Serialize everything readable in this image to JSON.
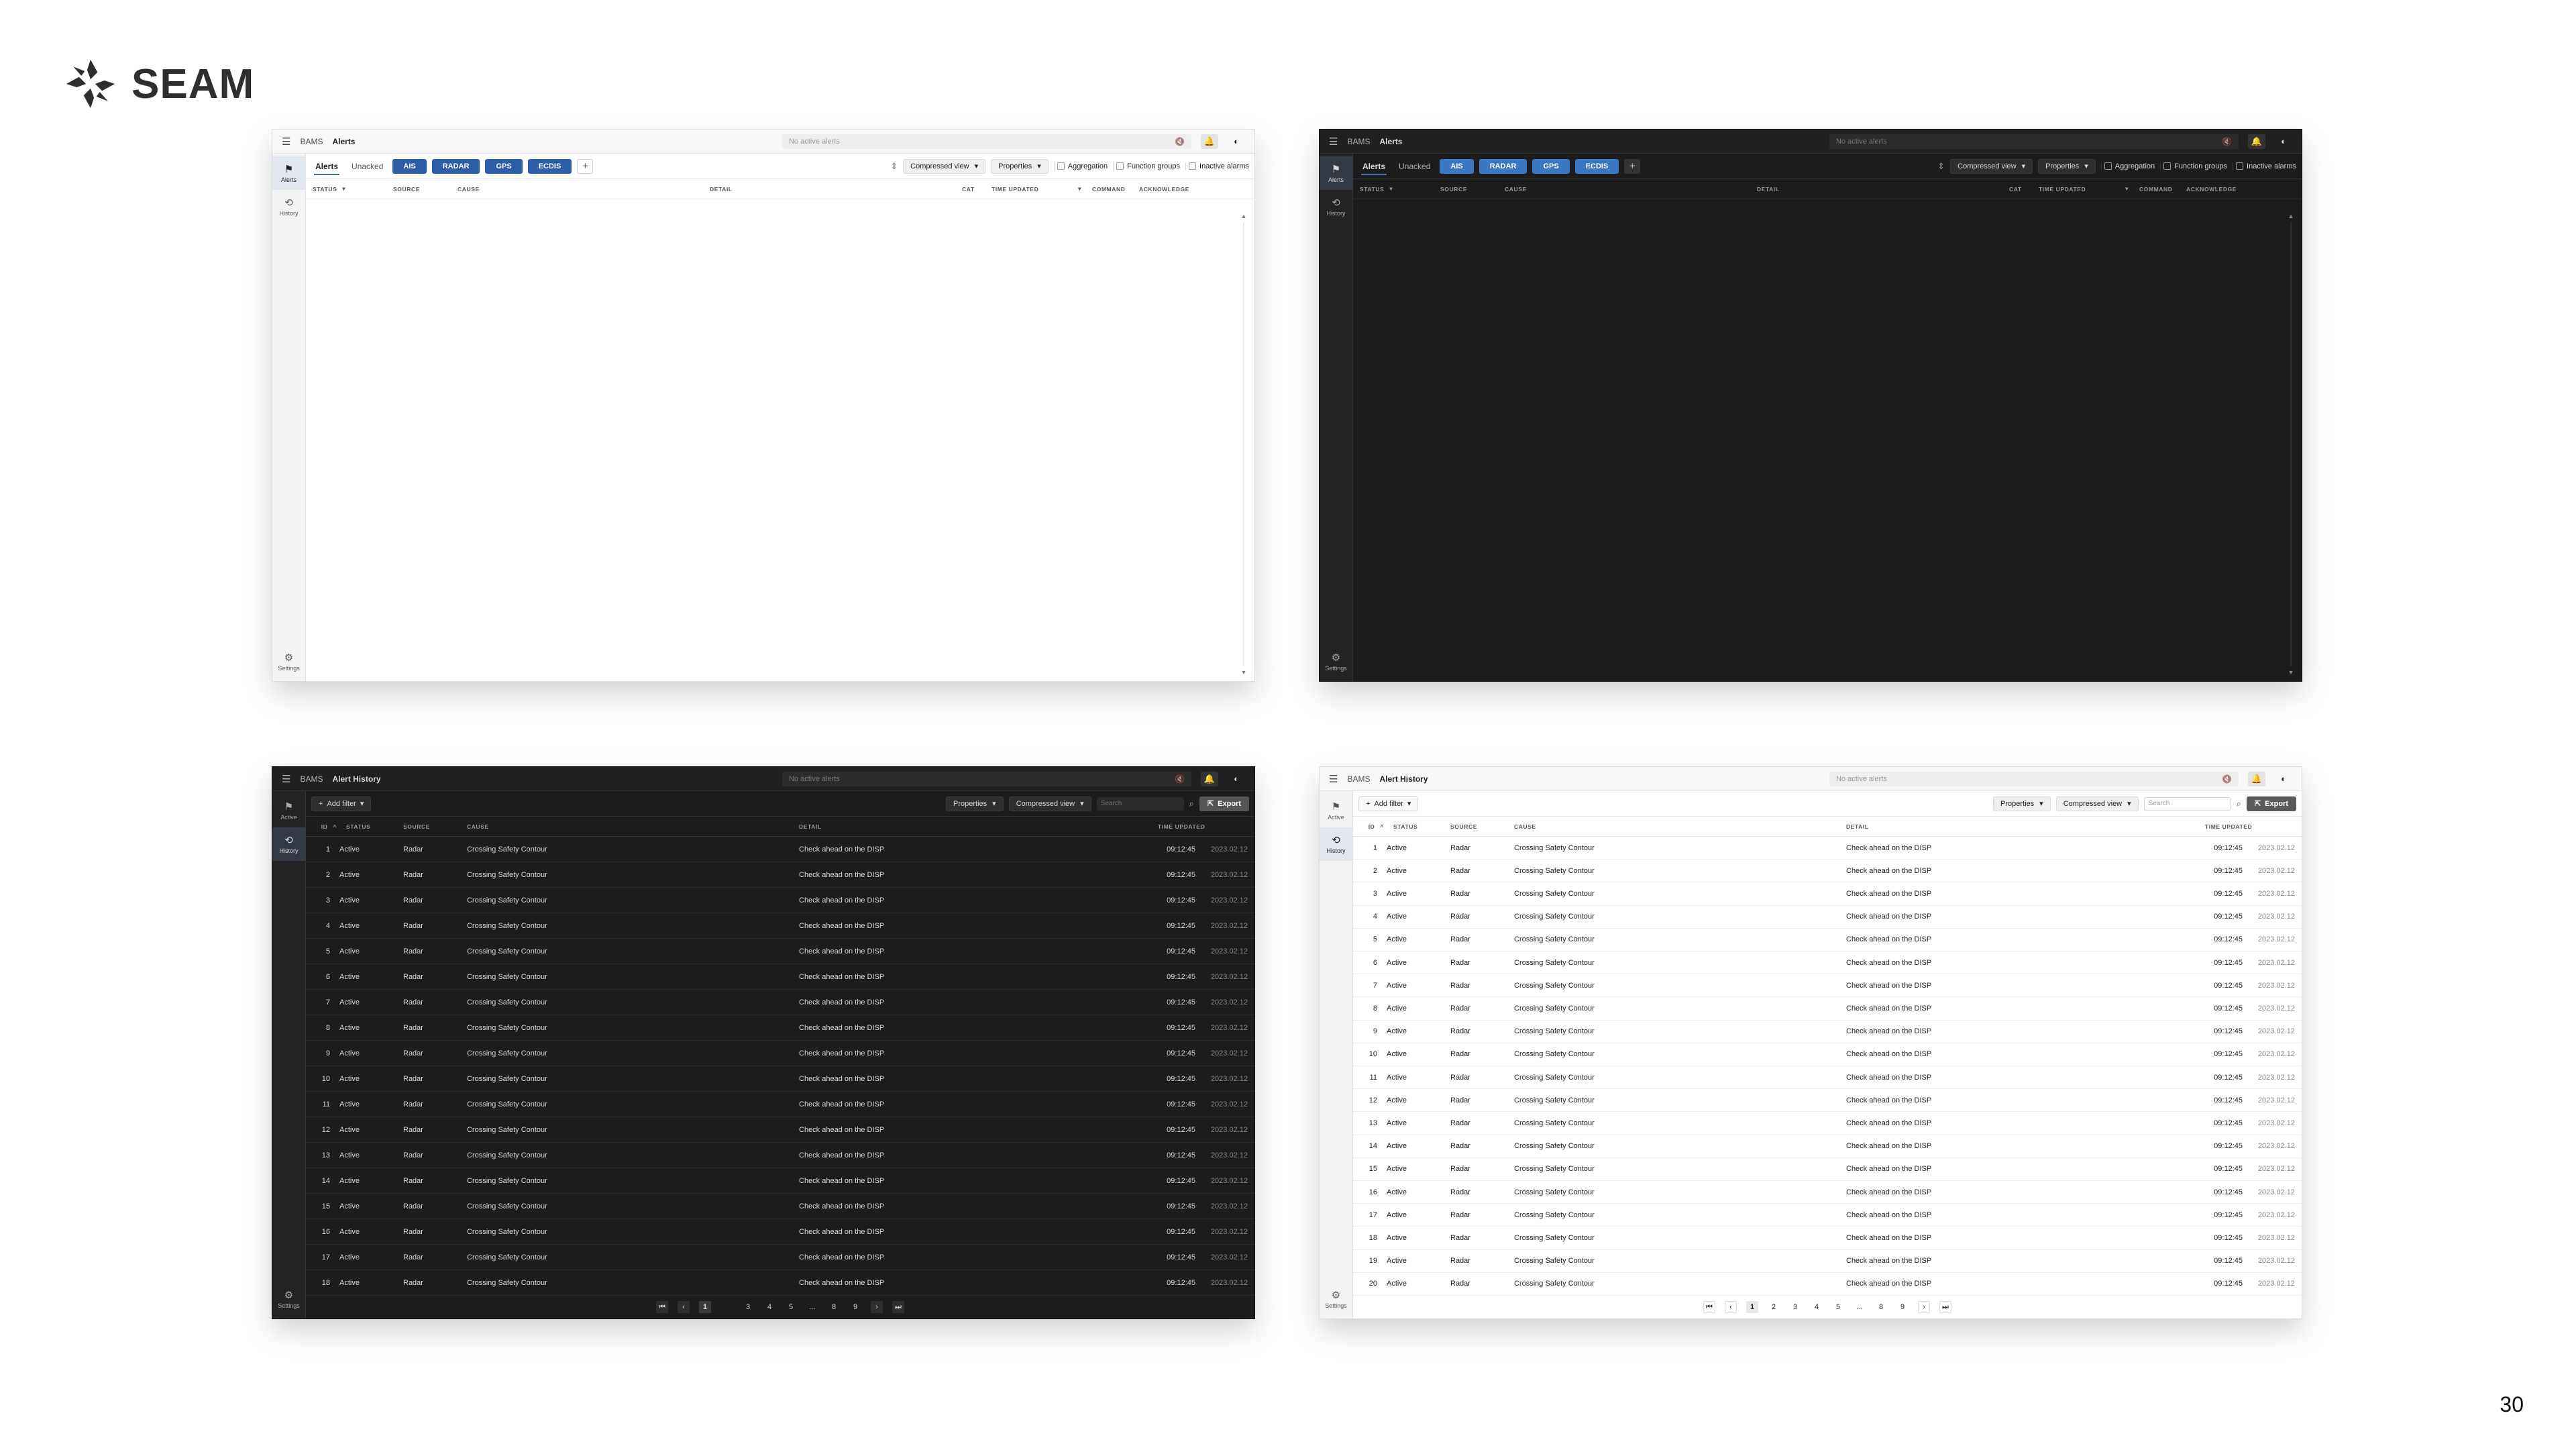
{
  "logo": {
    "text": "SEAM"
  },
  "page_number": "30",
  "common": {
    "app_name": "BAMS",
    "status_placeholder": "No active alerts",
    "settings_label": "Settings",
    "history_label": "History",
    "active_label": "Active",
    "alerts_label": "Alerts"
  },
  "alerts_view": {
    "title": "Alerts",
    "tabs": [
      "Alerts",
      "Unacked"
    ],
    "chips": [
      "AIS",
      "RADAR",
      "GPS",
      "ECDIS"
    ],
    "compressed_view": "Compressed view",
    "properties": "Properties",
    "checkboxes": [
      "Aggregation",
      "Function groups",
      "Inactive alarms"
    ],
    "columns": [
      "STATUS",
      "SOURCE",
      "CAUSE",
      "DETAIL",
      "CAT",
      "TIME UPDATED",
      "COMMAND",
      "ACKNOWLEDGE"
    ]
  },
  "history_view": {
    "title": "Alert History",
    "add_filter": "Add filter",
    "properties": "Properties",
    "compressed_view": "Compressed view",
    "search_placeholder": "Search",
    "export": "Export",
    "columns": [
      "ID",
      "STATUS",
      "SOURCE",
      "CAUSE",
      "DETAIL",
      "TIME UPDATED"
    ],
    "row_template": {
      "status": "Active",
      "source": "Radar",
      "cause": "Crossing Safety Contour",
      "detail": "Check ahead on the DISP",
      "time": "09:12:45",
      "date": "2023.02.12"
    },
    "dark_row_count": 18,
    "light_row_count": 20,
    "pagination_dark": [
      "1",
      "",
      "3",
      "4",
      "5",
      "...",
      "8",
      "9"
    ],
    "pagination_light": [
      "1",
      "2",
      "3",
      "4",
      "5",
      "...",
      "8",
      "9"
    ]
  },
  "colors": {
    "chip_light": "#2d5fa8",
    "chip_dark": "#3b78c4",
    "dark_bg": "#1c1c1c"
  }
}
